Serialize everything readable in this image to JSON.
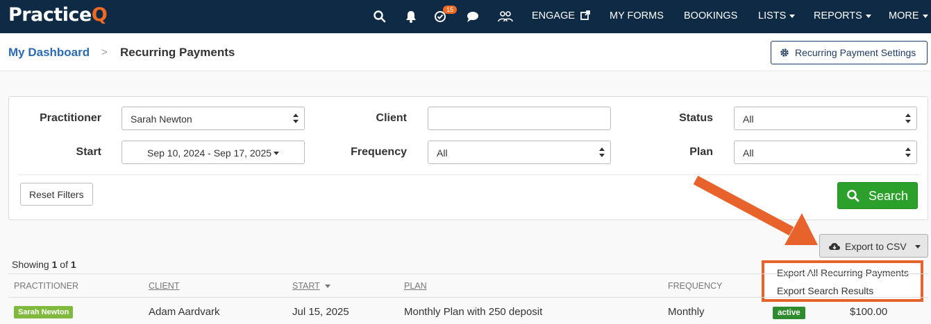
{
  "brand": {
    "logo_main": "Practice",
    "logo_accent": "Q"
  },
  "nav": {
    "badge_count": "15",
    "engage": "ENGAGE",
    "my_forms": "MY FORMS",
    "bookings": "BOOKINGS",
    "lists": "LISTS",
    "reports": "REPORTS",
    "more": "MORE"
  },
  "breadcrumb": {
    "home": "My Dashboard",
    "separator": ">",
    "current": "Recurring Payments"
  },
  "header": {
    "settings_button": "Recurring Payment Settings"
  },
  "filters": {
    "practitioner": {
      "label": "Practitioner",
      "value": "Sarah Newton"
    },
    "client": {
      "label": "Client",
      "value": ""
    },
    "status": {
      "label": "Status",
      "value": "All"
    },
    "start": {
      "label": "Start",
      "value": "Sep 10, 2024 - Sep 17, 2025"
    },
    "frequency": {
      "label": "Frequency",
      "value": "All"
    },
    "plan": {
      "label": "Plan",
      "value": "All"
    },
    "reset_button": "Reset Filters",
    "search_button": "Search"
  },
  "export": {
    "button": "Export to CSV",
    "menu": [
      "Export All Recurring Payments",
      "Export Search Results"
    ]
  },
  "results": {
    "showing_prefix": "Showing",
    "from": "1",
    "of_word": "of",
    "total": "1"
  },
  "table": {
    "columns": [
      "PRACTITIONER",
      "CLIENT",
      "START",
      "PLAN",
      "FREQUENCY"
    ],
    "rows": [
      {
        "practitioner": "Sarah Newton",
        "client": "Adam Aardvark",
        "start": "Jul 15, 2025",
        "plan": "Monthly Plan with 250 deposit",
        "frequency": "Monthly",
        "status": "active",
        "amount": "$100.00"
      }
    ]
  },
  "colors": {
    "nav_bg": "#0e2a44",
    "brand_accent": "#f26a21",
    "search_green": "#2ba02b",
    "annotation_orange": "#e8632b",
    "link_blue": "#2a6bb5"
  }
}
